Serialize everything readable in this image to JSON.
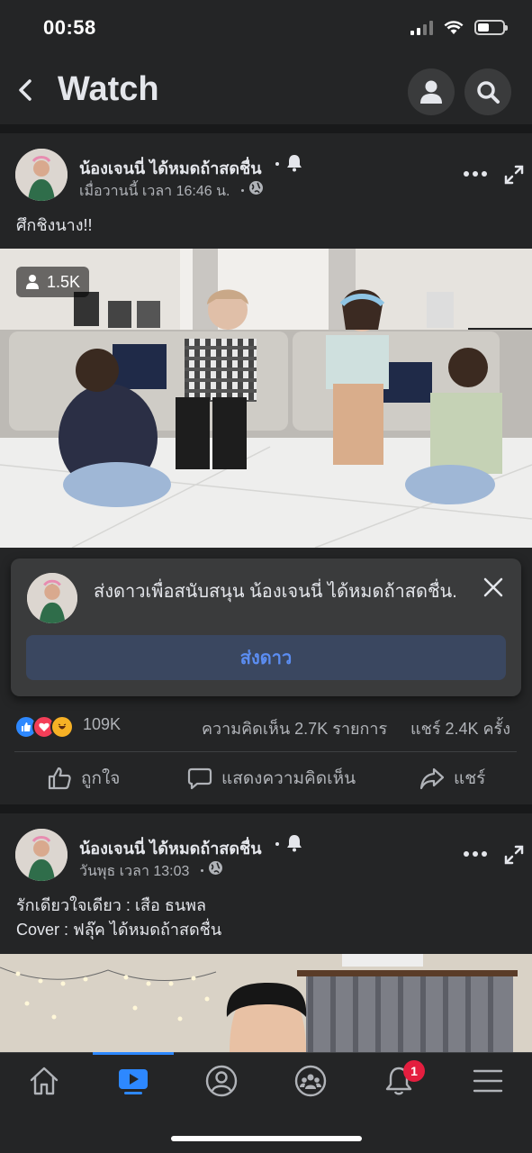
{
  "status_bar": {
    "time": "00:58"
  },
  "header": {
    "title": "Watch"
  },
  "posts": [
    {
      "author": "น้องเจนนี่ ได้หมดถ้าสดชื่น",
      "meta": "เมื่อวานนี้ เวลา 16:46 น.",
      "text": "ศึกชิงนาง!!",
      "viewers": "1.5K"
    },
    {
      "author": "น้องเจนนี่ ได้หมดถ้าสดชื่น",
      "meta": "วันพุธ เวลา 13:03",
      "text_line1": "รักเดียวใจเดียว : เสือ ธนพล",
      "text_line2": "Cover : ฟลุ๊ค ได้หมดถ้าสดชื่น"
    }
  ],
  "stars_prompt": {
    "text": "ส่งดาวเพื่อสนับสนุน น้องเจนนี่ ได้หมดถ้าสดชื่น.",
    "button": "ส่งดาว"
  },
  "stats": {
    "reactions": "109K",
    "comments": "ความคิดเห็น 2.7K รายการ",
    "shares": "แชร์ 2.4K ครั้ง"
  },
  "actions": {
    "like": "ถูกใจ",
    "comment": "แสดงความคิดเห็น",
    "share": "แชร์"
  },
  "tab_bar": {
    "notifications_badge": "1",
    "active": "watch"
  },
  "colors": {
    "background": "#18191a",
    "surface": "#242526",
    "accent": "#2d88ff",
    "badge": "#e41e3f"
  }
}
